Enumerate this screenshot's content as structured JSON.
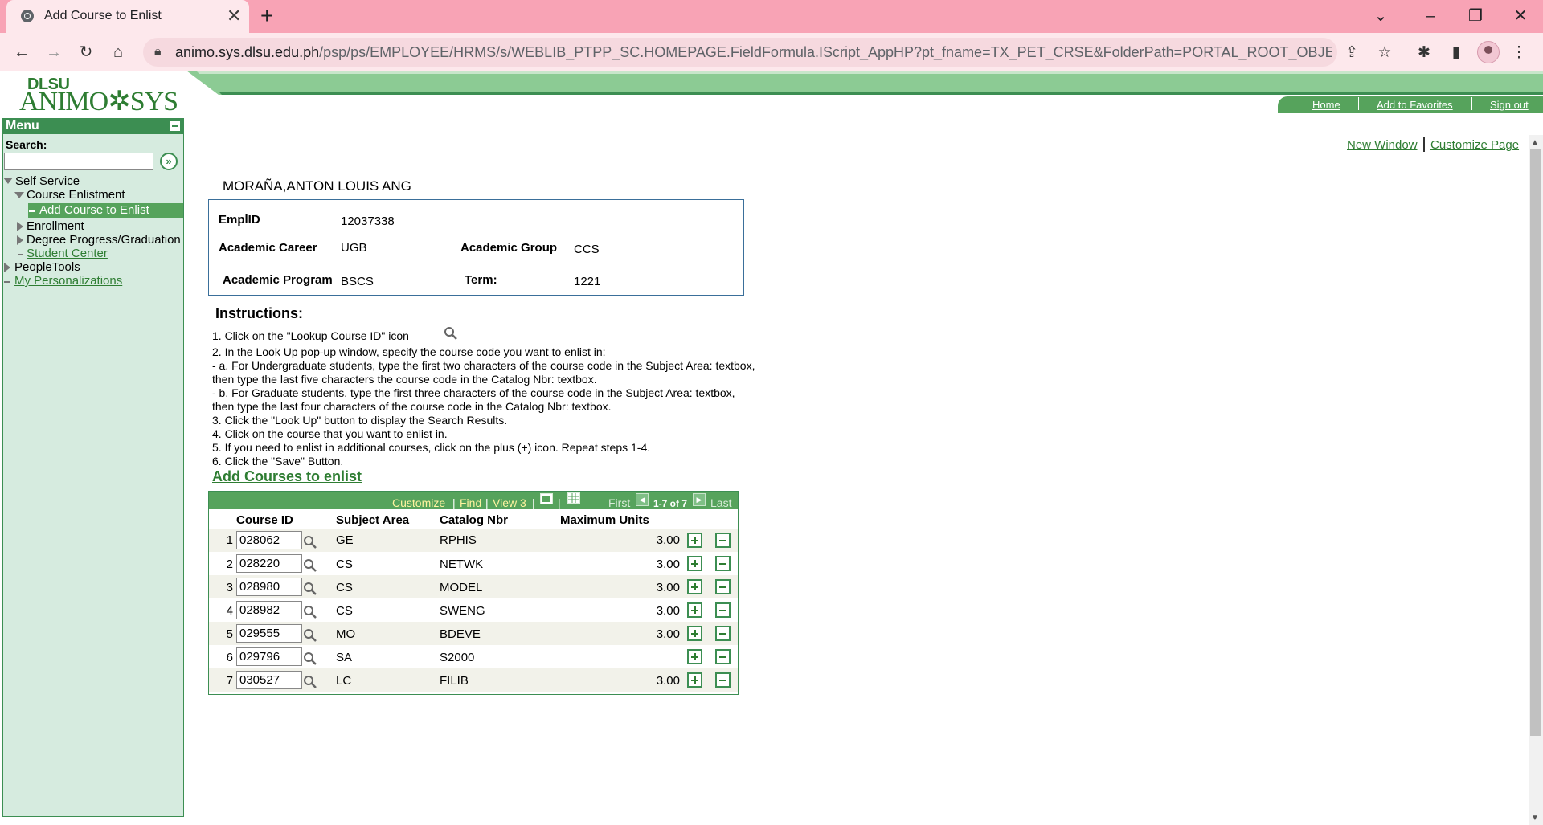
{
  "browser": {
    "tab_title": "Add Course to Enlist",
    "url_host": "animo.sys.dlsu.edu.ph",
    "url_path": "/psp/ps/EMPLOYEE/HRMS/s/WEBLIB_PTPP_SC.HOMEPAGE.FieldFormula.IScript_AppHP?pt_fname=TX_PET_CRSE&FolderPath=PORTAL_ROOT_OBJECT.CO_EMPLOYE..."
  },
  "header": {
    "logo_top": "DLSU",
    "logo_main": "ANIMO✲SYS",
    "links": [
      "Home",
      "Add to Favorites",
      "Sign out"
    ],
    "new_window": "New Window",
    "customize_page": "Customize Page"
  },
  "menu": {
    "title": "Menu",
    "search_label": "Search:",
    "search_value": "",
    "items": [
      {
        "label": "Self Service"
      },
      {
        "label": "Course Enlistment"
      },
      {
        "label": "Add Course to Enlist"
      },
      {
        "label": "Enrollment"
      },
      {
        "label": "Degree Progress/Graduation"
      },
      {
        "label": "Student Center"
      },
      {
        "label": "PeopleTools"
      },
      {
        "label": "My Personalizations"
      }
    ]
  },
  "student": {
    "name": "MORAÑA,ANTON LOUIS ANG",
    "emplid_label": "EmplID",
    "emplid": "12037338",
    "career_label": "Academic Career",
    "career": "UGB",
    "group_label": "Academic Group",
    "group": "CCS",
    "program_label": "Academic Program",
    "program": "BSCS",
    "term_label": "Term:",
    "term": "1221"
  },
  "instructions": {
    "title": "Instructions:",
    "lines": [
      "1. Click on the \"Lookup Course ID\" icon",
      "2. In the Look Up pop-up window, specify the course code you want to enlist in:",
      "- a. For Undergraduate students, type the first two characters of the course code in the Subject Area: textbox,",
      "then type the last five characters the course code in the Catalog Nbr: textbox.",
      "- b. For Graduate students, type the first three characters of the course code in the Subject Area: textbox,",
      "then type the last four characters of the course code in the Catalog Nbr: textbox.",
      "3. Click the \"Look Up\" button to display the Search Results.",
      "4. Click on the course that you want to enlist in.",
      "5. If you need to enlist in additional courses, click on the plus (+) icon. Repeat steps 1-4.",
      "6. Click the \"Save\" Button."
    ]
  },
  "grid": {
    "title": "Add Courses to enlist",
    "customize": "Customize",
    "find": "Find",
    "view": "View 3",
    "first": "First",
    "range": "1-7 of 7",
    "last": "Last",
    "columns": [
      "Course ID",
      "Subject Area",
      "Catalog Nbr",
      "Maximum Units"
    ],
    "rows": [
      {
        "n": "1",
        "course_id": "028062",
        "subject": "GE",
        "catalog": "RPHIS",
        "units": "3.00"
      },
      {
        "n": "2",
        "course_id": "028220",
        "subject": "CS",
        "catalog": "NETWK",
        "units": "3.00"
      },
      {
        "n": "3",
        "course_id": "028980",
        "subject": "CS",
        "catalog": "MODEL",
        "units": "3.00"
      },
      {
        "n": "4",
        "course_id": "028982",
        "subject": "CS",
        "catalog": "SWENG",
        "units": "3.00"
      },
      {
        "n": "5",
        "course_id": "029555",
        "subject": "MO",
        "catalog": "BDEVE",
        "units": "3.00"
      },
      {
        "n": "6",
        "course_id": "029796",
        "subject": "SA",
        "catalog": "S2000",
        "units": ""
      },
      {
        "n": "7",
        "course_id": "030527",
        "subject": "LC",
        "catalog": "FILIB",
        "units": "3.00"
      }
    ]
  }
}
